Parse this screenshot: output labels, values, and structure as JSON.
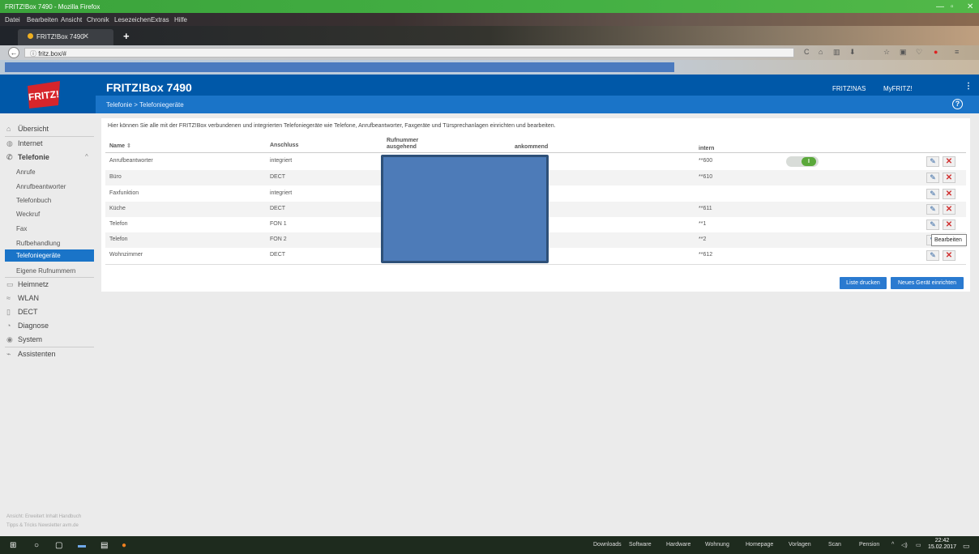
{
  "browser": {
    "window_title": "FRITZ!Box 7490 - Mozilla Firefox",
    "menu": [
      "Datei",
      "Bearbeiten",
      "Ansicht",
      "Chronik",
      "Lesezeichen",
      "Extras",
      "Hilfe"
    ],
    "tab_title": "FRITZ!Box 7490",
    "url": "fritz.box/#",
    "icons": [
      "back-icon",
      "info-icon",
      "reload-icon",
      "home-icon",
      "library-icon",
      "download-icon",
      "bookmark-star-icon",
      "pocket-icon",
      "adblock-icon",
      "menu-icon"
    ]
  },
  "header": {
    "logo_text": "FRITZ!",
    "title": "FRITZ!Box 7490",
    "breadcrumb": "Telefonie > Telefoniegeräte",
    "links": [
      "FRITZ!NAS",
      "MyFRITZ!"
    ],
    "help_symbol": "?"
  },
  "sidebar": {
    "items": [
      {
        "label": "Übersicht",
        "icon": "home-icon"
      },
      {
        "label": "Internet",
        "icon": "globe-icon"
      },
      {
        "label": "Telefonie",
        "icon": "phone-icon"
      },
      {
        "label": "Heimnetz",
        "icon": "network-icon"
      },
      {
        "label": "WLAN",
        "icon": "wifi-icon"
      },
      {
        "label": "DECT",
        "icon": "dect-phone-icon"
      },
      {
        "label": "Diagnose",
        "icon": "diagnose-icon"
      },
      {
        "label": "System",
        "icon": "system-icon"
      },
      {
        "label": "Assistenten",
        "icon": "wizard-icon"
      }
    ],
    "telefonie_sub": [
      "Anrufe",
      "Anrufbeantworter",
      "Telefonbuch",
      "Weckruf",
      "Fax",
      "Rufbehandlung",
      "Telefoniegeräte",
      "Eigene Rufnummern"
    ],
    "active_sub": "Telefoniegeräte",
    "footer_line1": "Ansicht: Erweitert   Inhalt   Handbuch",
    "footer_line2": "Tipps & Tricks   Newsletter   avm.de"
  },
  "main": {
    "intro": "Hier können Sie alle mit der FRITZ!Box verbundenen und integrierten Telefoniegeräte wie Telefone, Anrufbeantworter, Faxgeräte und Türsprechanlagen einrichten und bearbeiten.",
    "columns": {
      "name": "Name",
      "anschluss": "Anschluss",
      "rufnummer": "Rufnummer",
      "ausgehend": "ausgehend",
      "ankommend": "ankommend",
      "intern": "intern"
    },
    "rows": [
      {
        "name": "Anrufbeantworter",
        "anschluss": "integriert",
        "intern": "**600",
        "toggle_on": true
      },
      {
        "name": "Büro",
        "anschluss": "DECT",
        "intern": "**610"
      },
      {
        "name": "Faxfunktion",
        "anschluss": "integriert",
        "intern": ""
      },
      {
        "name": "Küche",
        "anschluss": "DECT",
        "intern": "**611"
      },
      {
        "name": "Telefon",
        "anschluss": "FON 1",
        "intern": "**1"
      },
      {
        "name": "Telefon",
        "anschluss": "FON 2",
        "intern": "**2"
      },
      {
        "name": "Wohnzimmer",
        "anschluss": "DECT",
        "intern": "**612"
      }
    ],
    "toggle_label": "I",
    "tooltip": "Bearbeiten",
    "buttons": {
      "print": "Liste drucken",
      "new": "Neues Gerät einrichten"
    }
  },
  "taskbar": {
    "toolbars": [
      "Downloads",
      "Software",
      "Hardware",
      "Wohnung",
      "Homepage",
      "Vorlagen",
      "Scan",
      "Pension"
    ],
    "time": "22:42",
    "date": "15.02.2017"
  }
}
